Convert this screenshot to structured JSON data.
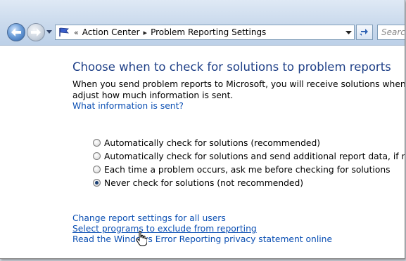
{
  "addressbar": {
    "overflow_glyph": "«",
    "breadcrumbs": [
      "Action Center",
      "Problem Reporting Settings"
    ],
    "separator": "▸"
  },
  "search": {
    "placeholder": "Search"
  },
  "page": {
    "title": "Choose when to check for solutions to problem reports",
    "description_line1": "When you send problem reports to Microsoft, you will receive solutions when they are available. You can",
    "description_line2": "adjust how much information is sent.",
    "info_link": "What information is sent?"
  },
  "options": [
    {
      "label": "Automatically check for solutions (recommended)",
      "checked": false
    },
    {
      "label": "Automatically check for solutions and send additional report data, if needed",
      "checked": false
    },
    {
      "label": "Each time a problem occurs, ask me before checking for solutions",
      "checked": false
    },
    {
      "label": "Never check for solutions (not recommended)",
      "checked": true
    }
  ],
  "links": {
    "change_all_users": "Change report settings for all users",
    "exclude_programs": "Select programs to exclude from reporting",
    "privacy_statement": "Read the Windows Error Reporting privacy statement online"
  },
  "colors": {
    "title": "#1e3f87",
    "link": "#0b4fb3",
    "toolbar_top": "#dfe9f5",
    "toolbar_bottom": "#bcd0e8"
  },
  "icons": [
    "back-arrow-icon",
    "forward-arrow-icon",
    "chevron-down-icon",
    "action-center-flag-icon",
    "refresh-icon",
    "hand-pointer-icon"
  ]
}
